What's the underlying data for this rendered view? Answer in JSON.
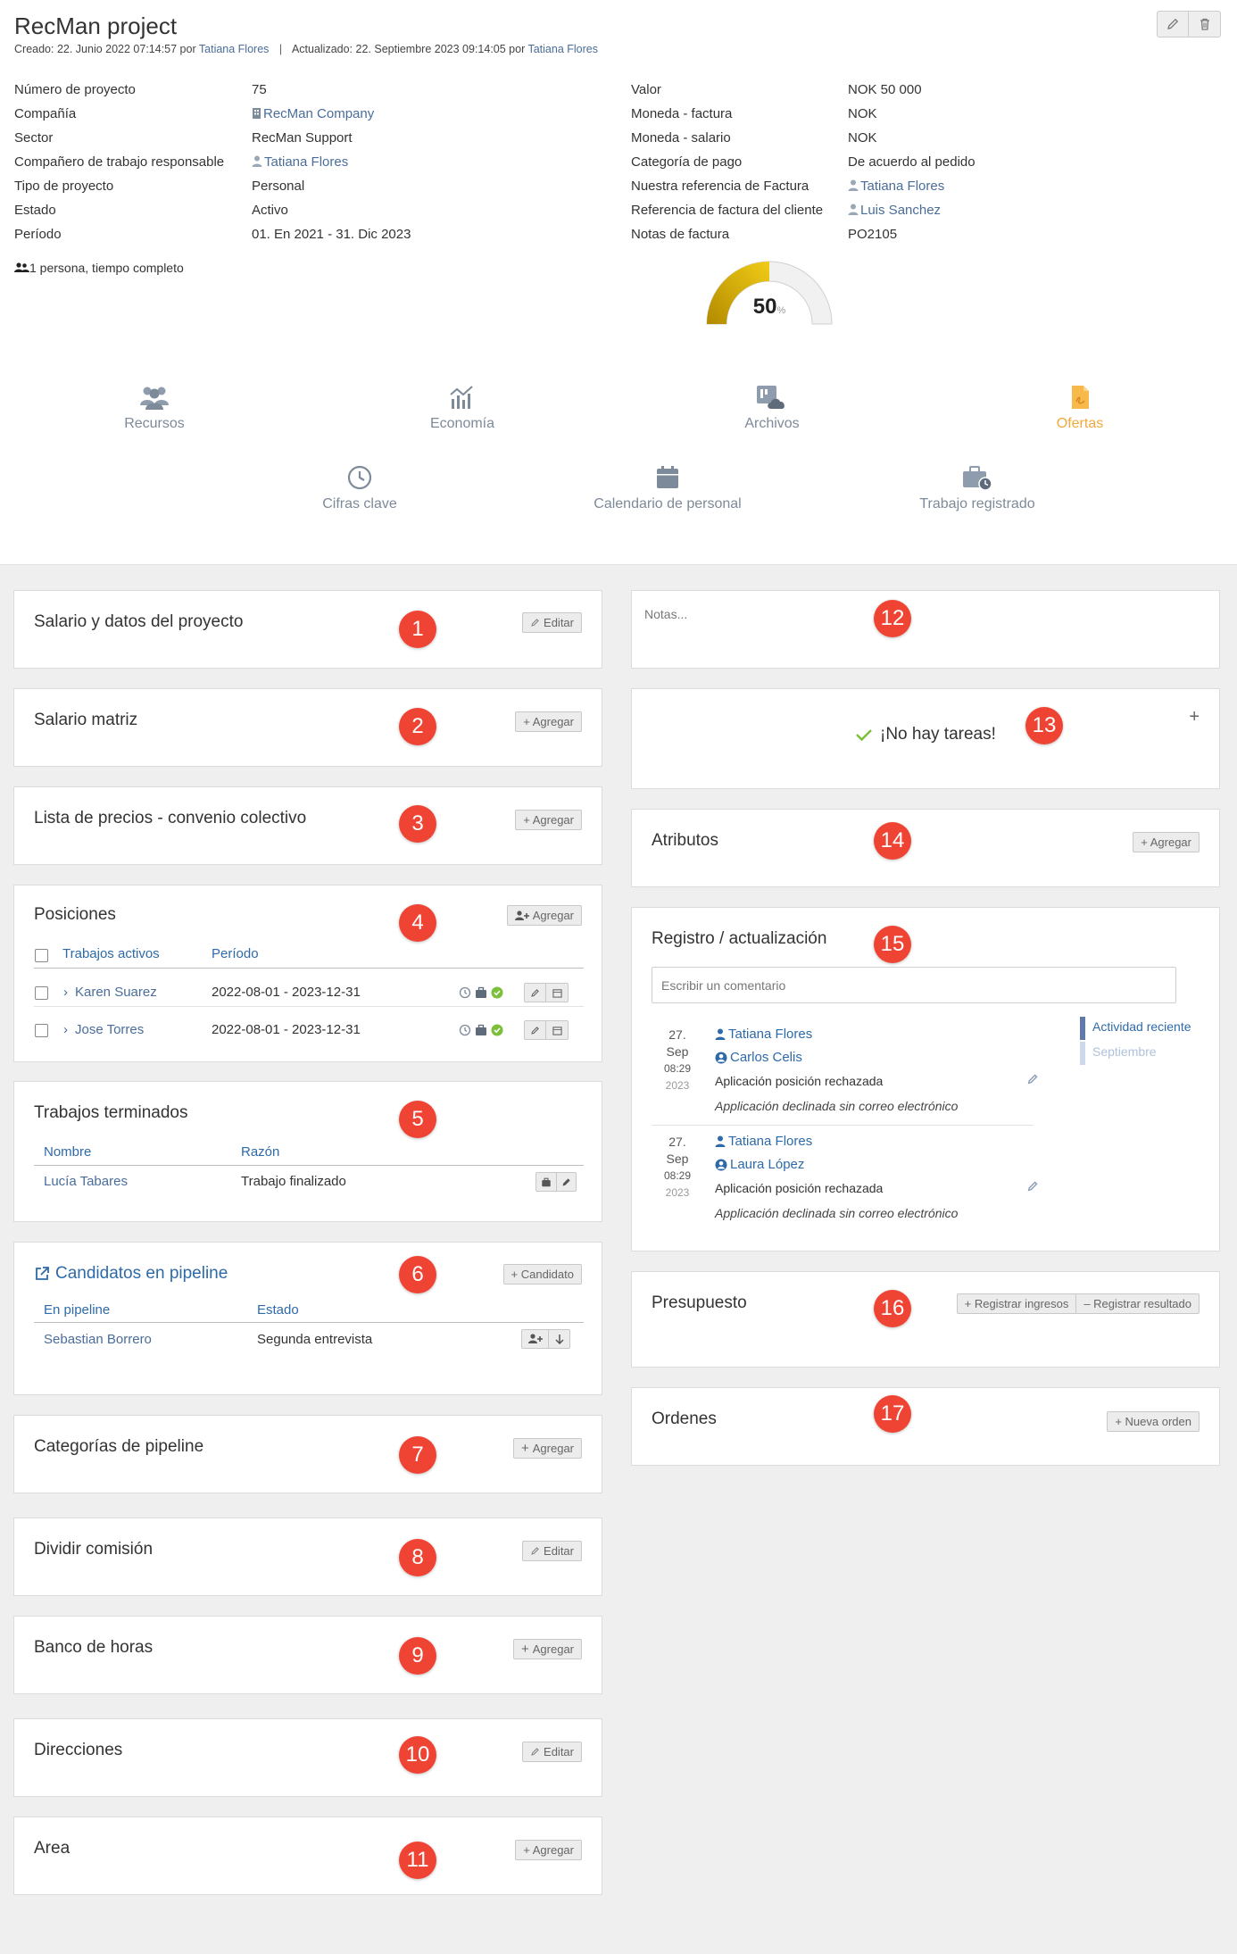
{
  "header": {
    "title": "RecMan project",
    "created_label": "Creado: 22. Junio 2022 07:14:57 por",
    "created_by": "Tatiana Flores",
    "separator": "|",
    "updated_label": "Actualizado: 22. Septiembre 2023 09:14:05 por",
    "updated_by": "Tatiana Flores"
  },
  "project_info": [
    {
      "label": "Número de proyecto",
      "value": "75"
    },
    {
      "label": "Compañía",
      "value": "RecMan Company"
    },
    {
      "label": "Sector",
      "value": "RecMan Support"
    },
    {
      "label": "Compañero de trabajo responsable",
      "value": "Tatiana Flores"
    },
    {
      "label": "Tipo de proyecto",
      "value": "Personal"
    },
    {
      "label": "Estado",
      "value": "Activo"
    },
    {
      "label": "Período",
      "value": "01. En 2021 - 31. Dic 2023"
    }
  ],
  "finance_info": [
    {
      "label": "Valor",
      "value": "NOK 50 000"
    },
    {
      "label": "Moneda - factura",
      "value": "NOK"
    },
    {
      "label": "Moneda - salario",
      "value": "NOK"
    },
    {
      "label": "Categoría de pago",
      "value": "De acuerdo al pedido"
    },
    {
      "label": "Nuestra referencia de Factura",
      "value": "Tatiana Flores"
    },
    {
      "label": "Referencia de factura del cliente",
      "value": "Luis Sanchez"
    },
    {
      "label": "Notas de factura",
      "value": "PO2105"
    }
  ],
  "people_note": "1 persona, tiempo completo",
  "gauge": {
    "value": "50",
    "unit": "%",
    "fraction": 0.5,
    "color": "#d9b00a"
  },
  "nav": [
    {
      "label": "Recursos"
    },
    {
      "label": "Economía"
    },
    {
      "label": "Archivos"
    },
    {
      "label": "Ofertas"
    },
    {
      "label": "Cifras clave"
    },
    {
      "label": "Calendario de personal"
    },
    {
      "label": "Trabajo registrado"
    }
  ],
  "badges": [
    "1",
    "2",
    "3",
    "4",
    "5",
    "6",
    "7",
    "8",
    "9",
    "10",
    "11",
    "12",
    "13",
    "14",
    "15",
    "16",
    "17"
  ],
  "cards": {
    "salario_datos": {
      "title": "Salario y datos del proyecto",
      "button": "Editar"
    },
    "salario_matriz": {
      "title": "Salario matriz",
      "button": "+ Agregar"
    },
    "lista_precios": {
      "title": "Lista de precios - convenio colectivo",
      "button": "+ Agregar"
    },
    "posiciones": {
      "title": "Posiciones",
      "button": "Agregar",
      "col1": "Trabajos activos",
      "col2": "Período",
      "rows": [
        {
          "name": "Karen Suarez",
          "period": "2022-08-01 - 2023-12-31"
        },
        {
          "name": "Jose Torres",
          "period": "2022-08-01 - 2023-12-31"
        }
      ]
    },
    "terminados": {
      "title": "Trabajos terminados",
      "col1": "Nombre",
      "col2": "Razón",
      "rows": [
        {
          "name": "Lucía Tabares",
          "reason": "Trabajo finalizado"
        }
      ]
    },
    "pipeline": {
      "title": "Candidatos en pipeline",
      "button": "+ Candidato",
      "col1": "En pipeline",
      "col2": "Estado",
      "rows": [
        {
          "name": "Sebastian Borrero",
          "state": "Segunda entrevista"
        }
      ]
    },
    "categorias": {
      "title": "Categorías de pipeline",
      "button": "Agregar"
    },
    "comision": {
      "title": "Dividir comisión",
      "button": "Editar"
    },
    "banco": {
      "title": "Banco de horas",
      "button": "Agregar"
    },
    "direcciones": {
      "title": "Direcciones",
      "button": "Editar"
    },
    "area": {
      "title": "Area",
      "button": "+ Agregar"
    },
    "notas": {
      "placeholder": "Notas..."
    },
    "tareas": {
      "text": "¡No hay tareas!",
      "plus": "+"
    },
    "atributos": {
      "title": "Atributos",
      "button": "+ Agregar"
    },
    "registro": {
      "title": "Registro / actualización",
      "comment_placeholder": "Escribir un comentario",
      "entries": [
        {
          "day": "27.",
          "month": "Sep",
          "time": "08:29",
          "year": "2023",
          "user1": "Tatiana Flores",
          "user2": "Carlos Celis",
          "action": "Aplicación posición rechazada",
          "detail": "Applicación declinada sin correo electrónico"
        },
        {
          "day": "27.",
          "month": "Sep",
          "time": "08:29",
          "year": "2023",
          "user1": "Tatiana Flores",
          "user2": "Laura López",
          "action": "Aplicación posición rechazada",
          "detail": "Applicación declinada sin correo electrónico"
        }
      ],
      "timeline": [
        "Actividad reciente",
        "Septiembre"
      ]
    },
    "presupuesto": {
      "title": "Presupuesto",
      "button1": "+ Registrar ingresos",
      "button2": "– Registrar resultado"
    },
    "ordenes": {
      "title": "Ordenes",
      "button": "+ Nueva orden"
    }
  }
}
